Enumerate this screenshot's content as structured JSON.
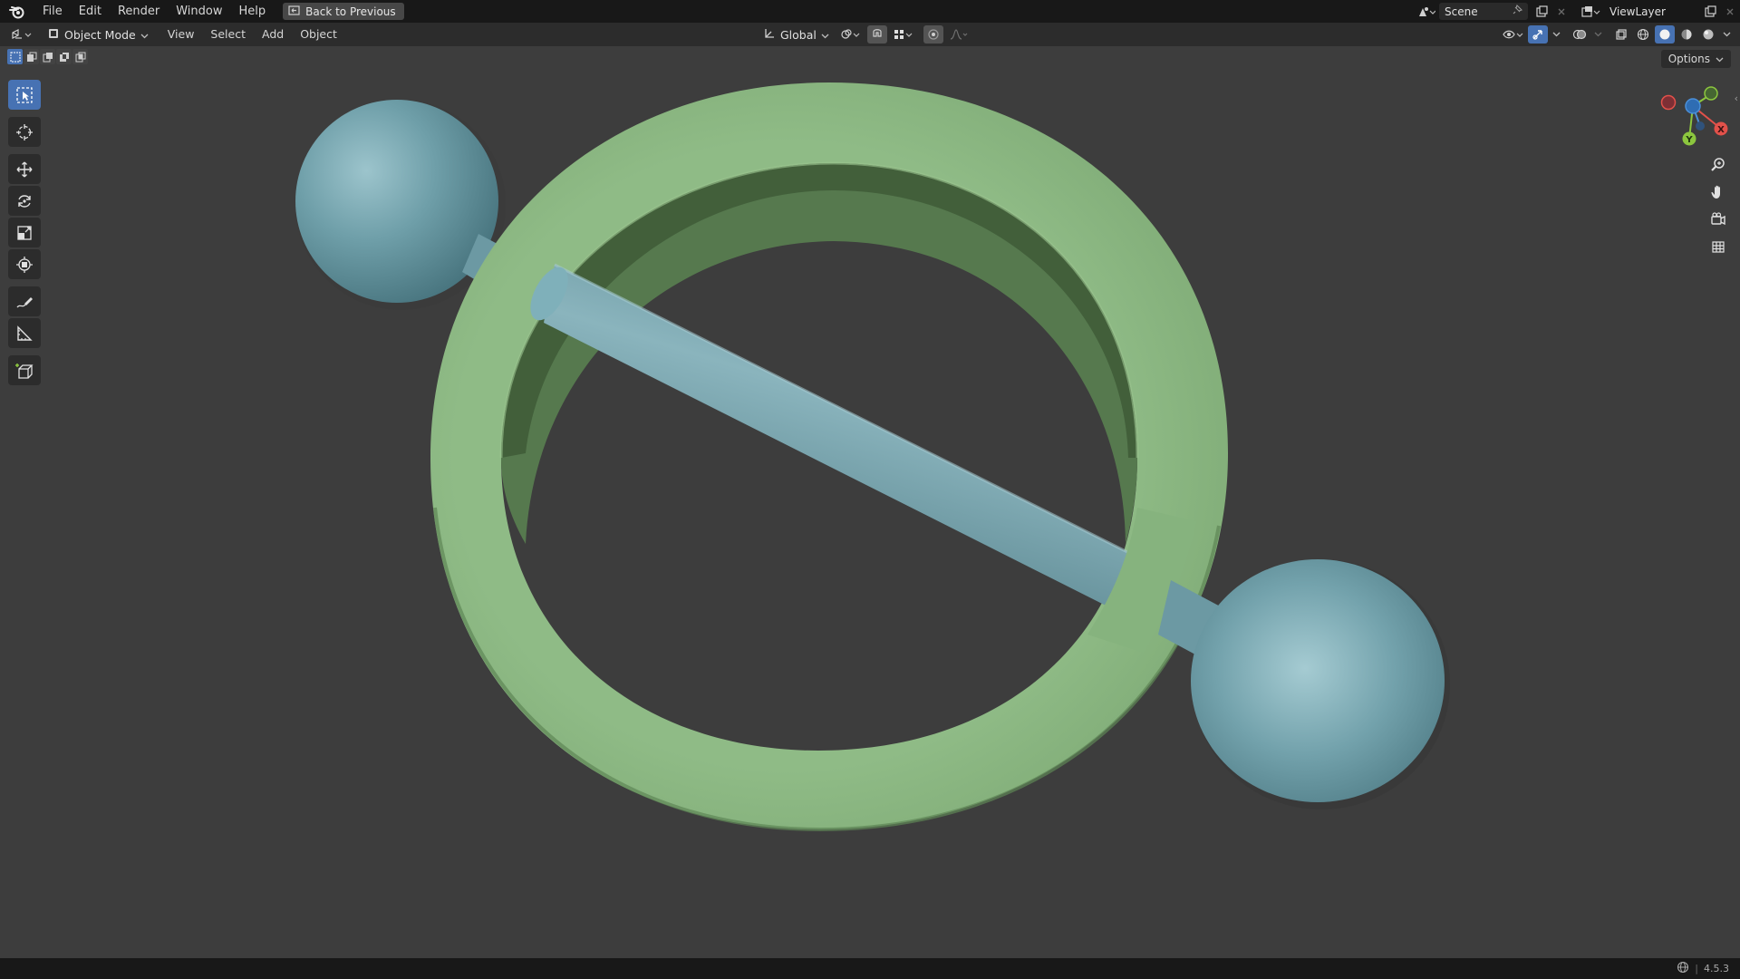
{
  "topbar": {
    "logo": "blender-logo-icon",
    "menus": [
      "File",
      "Edit",
      "Render",
      "Window",
      "Help"
    ],
    "back_button": "Back to Previous",
    "scene_name": "Scene",
    "view_layer": "ViewLayer"
  },
  "viewport_header": {
    "editor_type_icon": "3d-viewport-icon",
    "mode": "Object Mode",
    "menus": [
      "View",
      "Select",
      "Add",
      "Object"
    ],
    "transform_orientation": "Global",
    "options_label": "Options"
  },
  "toolbar": {
    "tools": [
      "select-box-icon",
      "cursor-icon",
      "move-icon",
      "rotate-icon",
      "scale-icon",
      "transform-icon",
      "annotate-icon",
      "measure-icon",
      "add-cube-icon"
    ],
    "active_tool": "select-box-icon"
  },
  "navigation": {
    "gizmo_axes": {
      "x": "X",
      "y": "Y",
      "z": "Z"
    },
    "buttons": [
      "zoom-icon",
      "pan-hand-icon",
      "camera-view-icon",
      "grid-ortho-icon"
    ]
  },
  "scene": {
    "objects": [
      "torus-ring",
      "sphere-top-left",
      "sphere-bottom-right",
      "rod-cylinder"
    ],
    "colors": {
      "background": "#3d3d3d",
      "ring": "#8fba84",
      "ring_shadow": "#5f8a58",
      "teal": "#6e9ca6",
      "teal_dark": "#4a737e"
    }
  },
  "statusbar": {
    "version": "4.5.3"
  },
  "colors": {
    "accent": "#4772b3",
    "axis_x": "#e2514a",
    "axis_y": "#8cc63e",
    "axis_z": "#4a8fd9"
  }
}
